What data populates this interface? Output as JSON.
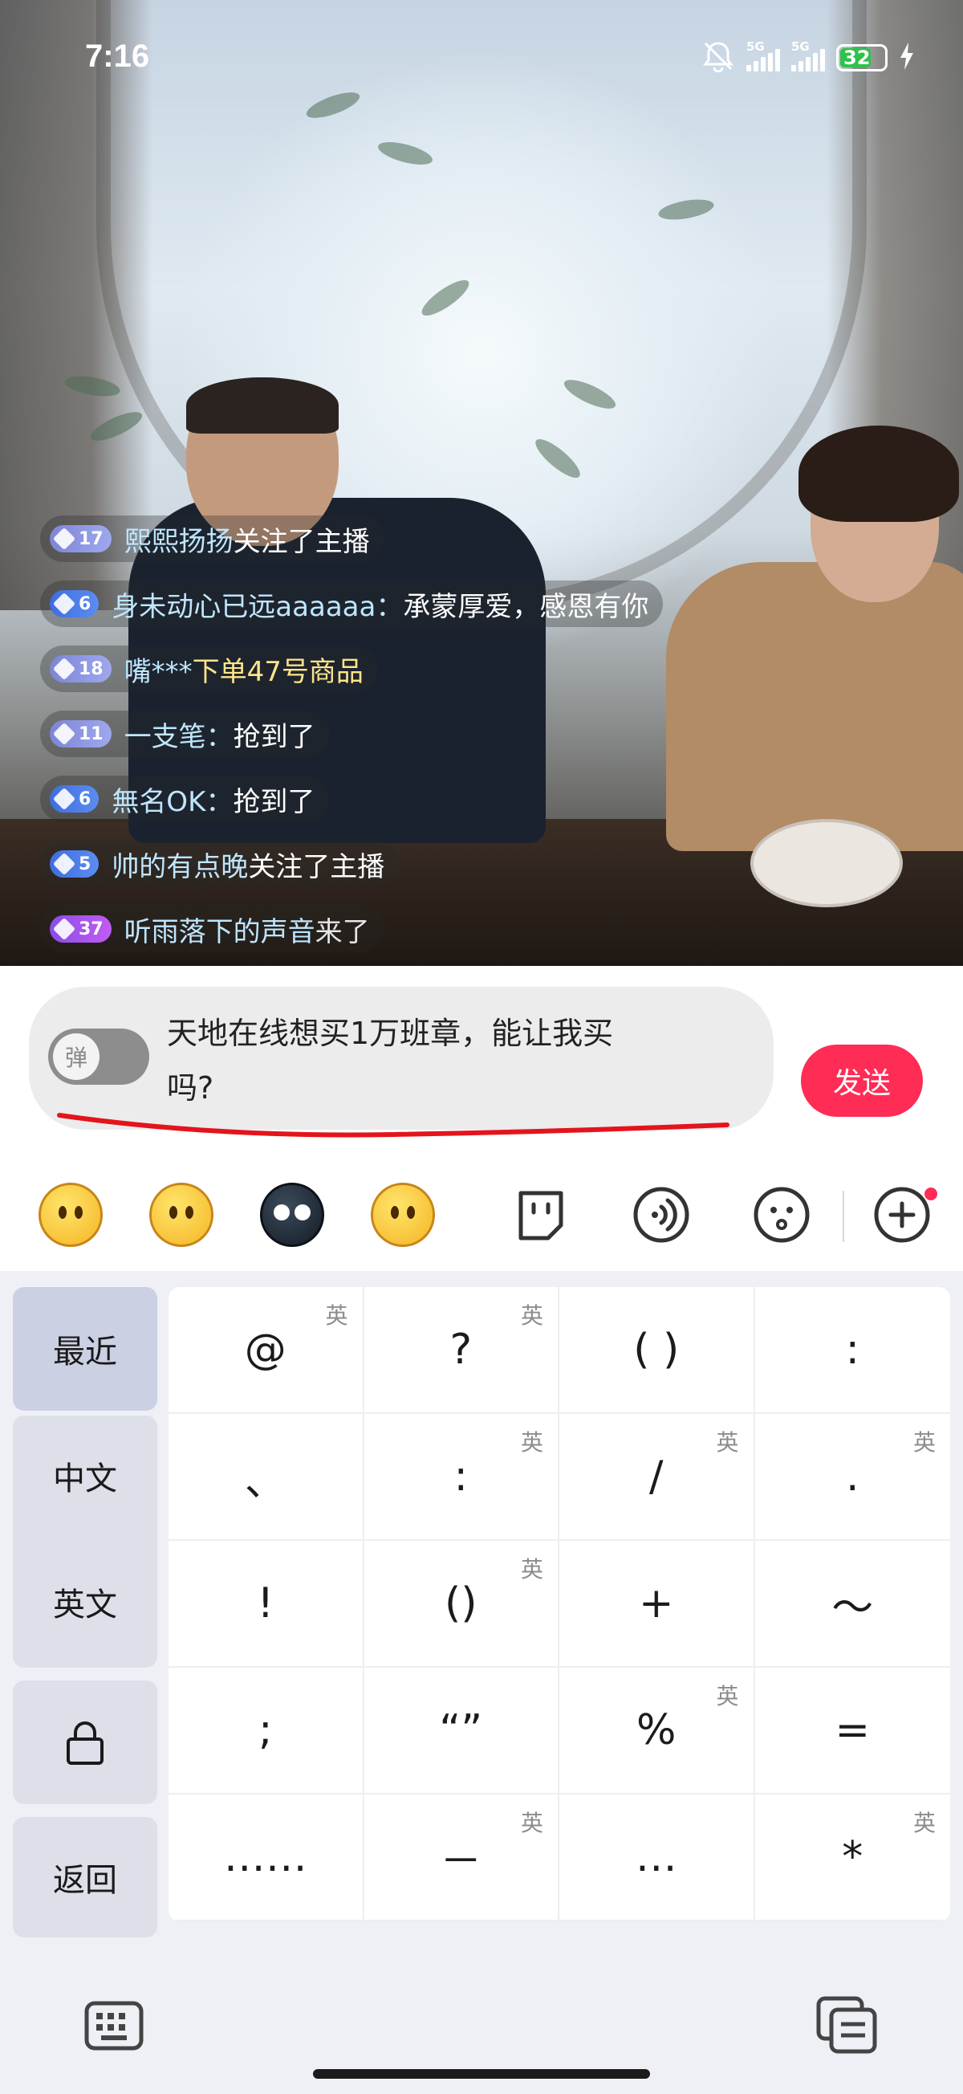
{
  "status_bar": {
    "time": "7:16",
    "network_1": "5G",
    "network_2": "5G",
    "battery": "32"
  },
  "chat": {
    "messages": [
      {
        "level": "17",
        "user": "熙熙扬扬",
        "text": "关注了主播",
        "style": "plain"
      },
      {
        "level": "6",
        "user": "身未动心已远aaaaaa：",
        "text": "承蒙厚爱，感恩有你",
        "style": "plain"
      },
      {
        "level": "18",
        "user": "嘴***",
        "text": "下单47号商品",
        "style": "yellow"
      },
      {
        "level": "11",
        "user": "一支笔：",
        "text": "抢到了",
        "style": "plain"
      },
      {
        "level": "6",
        "user": "無名OK：",
        "text": "抢到了",
        "style": "plain"
      },
      {
        "level": "5",
        "user": "帅的有点晚",
        "text": "关注了主播",
        "style": "plain"
      },
      {
        "level": "37",
        "user": "听雨落下的声音",
        "text": "来了",
        "style": "dim"
      }
    ]
  },
  "input": {
    "toggle_label": "弹",
    "text_line1": "天地在线想买1万班章，能让我买",
    "text_line2": "吗?",
    "send_label": "发送"
  },
  "toolbar": {
    "items": [
      "thinking-emoji",
      "grin-sweat-emoji",
      "dark-blob-emoji",
      "smile-emoji",
      "sticker-icon",
      "voice-icon",
      "face-icon",
      "add-icon"
    ]
  },
  "keyboard": {
    "side": [
      "最近",
      "中文",
      "英文",
      "返回"
    ],
    "tag": "英",
    "keys": [
      {
        "label": "@",
        "en": true
      },
      {
        "label": "?",
        "en": true
      },
      {
        "label": "( )",
        "en": false
      },
      {
        "label": ":",
        "en": false
      },
      {
        "label": "、",
        "en": false
      },
      {
        "label": ":",
        "en": true
      },
      {
        "label": "/",
        "en": true
      },
      {
        "label": ".",
        "en": true
      },
      {
        "label": "!",
        "en": false
      },
      {
        "label": "()",
        "en": true
      },
      {
        "label": "+",
        "en": false
      },
      {
        "label": "～",
        "en": false
      },
      {
        "label": ";",
        "en": false
      },
      {
        "label": "“”",
        "en": false
      },
      {
        "label": "%",
        "en": true
      },
      {
        "label": "=",
        "en": false
      },
      {
        "label": "……",
        "en": false
      },
      {
        "label": "－",
        "en": true
      },
      {
        "label": "…",
        "en": false
      },
      {
        "label": "*",
        "en": true
      }
    ]
  },
  "colors": {
    "send": "#ff2c55",
    "username": "#bfe6ff",
    "battery_fill": "#2fc14b"
  }
}
